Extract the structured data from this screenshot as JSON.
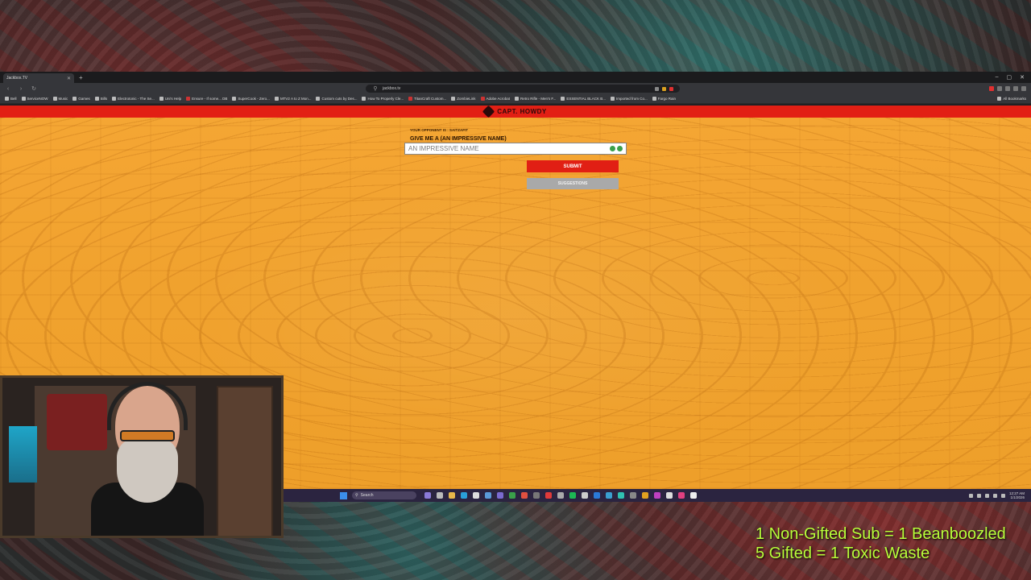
{
  "browser": {
    "tab_title": "Jackbox.TV",
    "url": "jackbox.tv",
    "bookmarks": [
      "Bell",
      "ServiceNOW",
      "Music",
      "Games",
      "Bills",
      "Electrotonic - The Se...",
      "Uni's Help",
      "Ensure - If some... DB",
      "SuperCook - Zero...",
      "MTV2 A to Z Mon...",
      "Custom cuts by Des...",
      "How To Properly Cle...",
      "TitanCraft Custom...",
      "ZombieLink",
      "Adobe Acrobat",
      "Retro Rifle - Men's F...",
      "ESSENTIAL BLACK B...",
      "Imported from Co...",
      "Fargo Rain"
    ],
    "all_bookmarks": "All Bookmarks"
  },
  "game": {
    "player_name": "CAPT. HOWDY",
    "opponent": "YOUR OPPONENT IS : SAITZAFIT",
    "prompt": "GIVE ME A (AN IMPRESSIVE NAME)",
    "input_placeholder": "AN IMPRESSIVE NAME",
    "submit_label": "SUBMIT",
    "suggestions_label": "SUGGESTIONS",
    "accent_color": "#e21f14",
    "background_color": "#f0a22e"
  },
  "taskbar": {
    "search_label": "Search",
    "clock_time": "12:27 AM",
    "clock_date": "1/1/2026"
  },
  "overlay": {
    "line1": "1 Non-Gifted Sub = 1 Beanboozled",
    "line2": "5 Gifted = 1 Toxic Waste",
    "text_color": "#b8ff3a"
  }
}
